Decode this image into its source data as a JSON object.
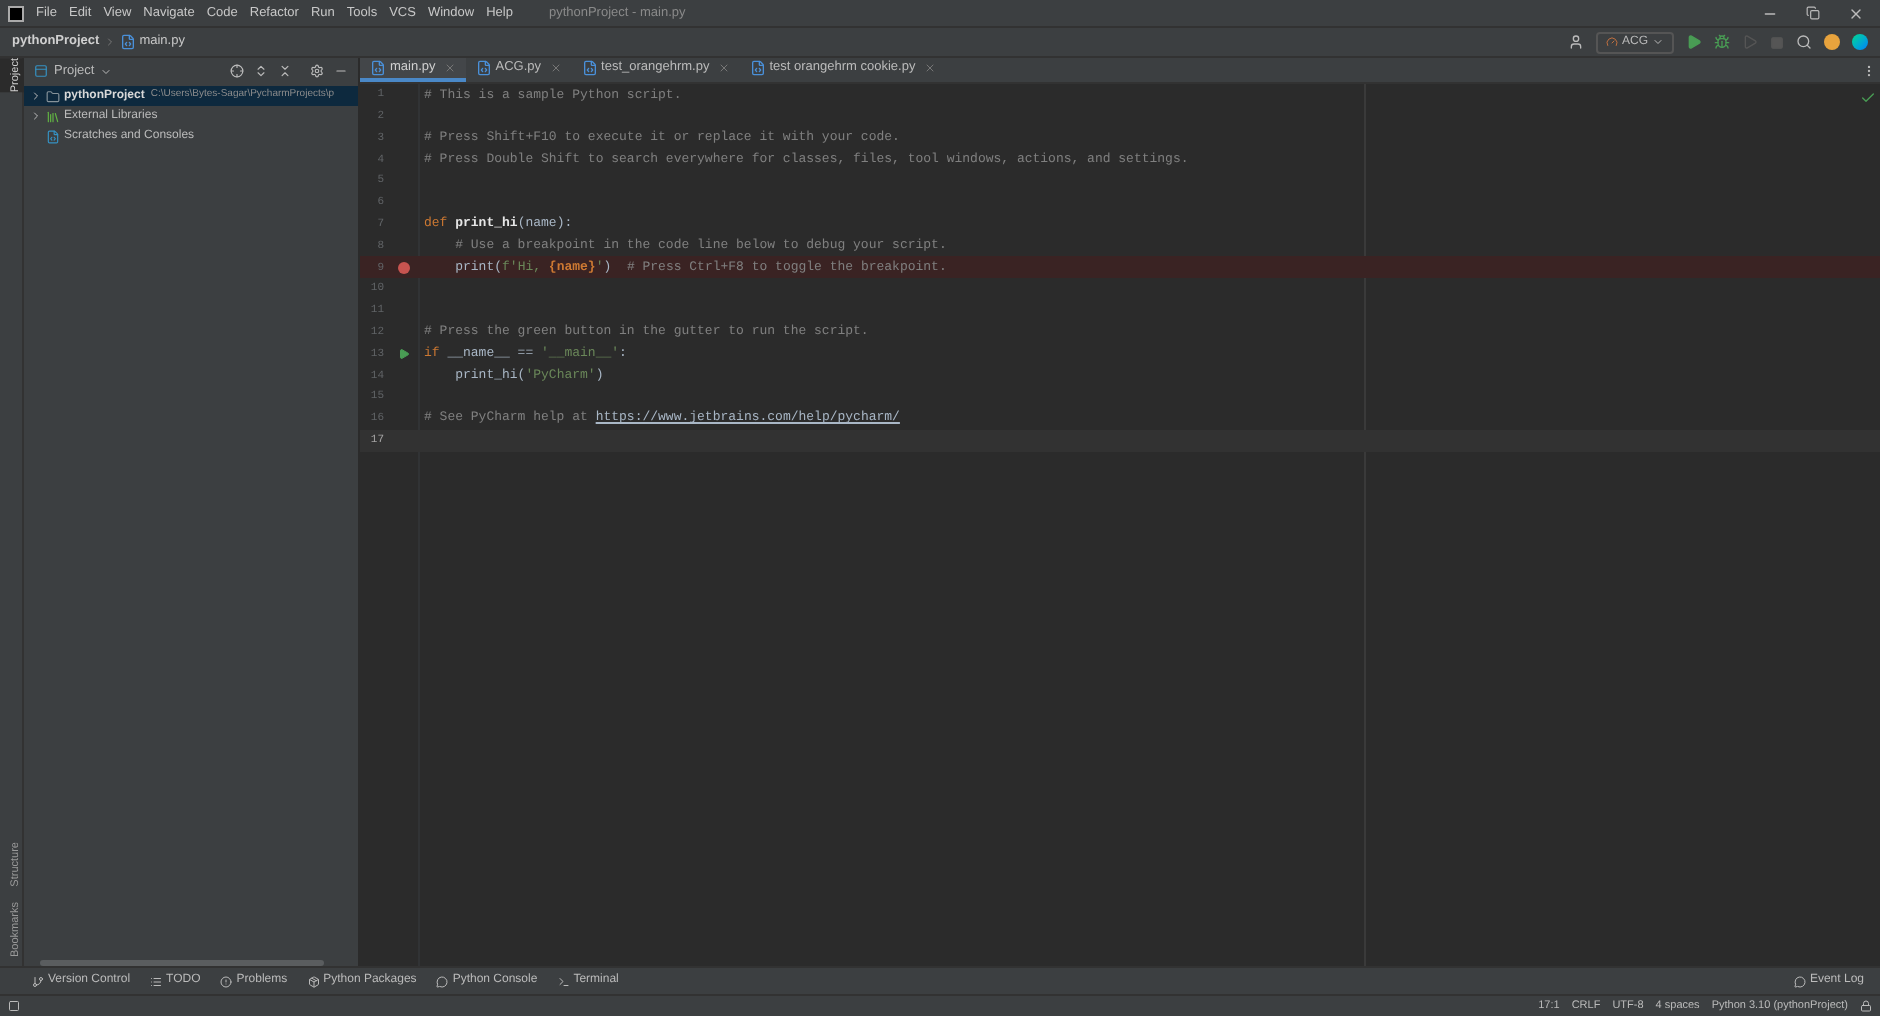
{
  "window": {
    "title": "pythonProject - main.py",
    "menu": [
      "File",
      "Edit",
      "View",
      "Navigate",
      "Code",
      "Refactor",
      "Run",
      "Tools",
      "VCS",
      "Window",
      "Help"
    ]
  },
  "navbar": {
    "breadcrumbs": [
      "pythonProject",
      "main.py"
    ],
    "run_config": "ACG"
  },
  "left_strip": {
    "top": [
      {
        "label": "Project",
        "selected": true
      }
    ],
    "bottom": [
      {
        "label": "Structure",
        "selected": false
      },
      {
        "label": "Bookmarks",
        "selected": false
      }
    ]
  },
  "project_panel": {
    "title": "Project",
    "tree": [
      {
        "label": "pythonProject",
        "path": "C:\\Users\\Bytes-Sagar\\PycharmProjects\\p",
        "kind": "project",
        "expanded": false,
        "selected": true
      },
      {
        "label": "External Libraries",
        "kind": "library",
        "expanded": false,
        "selected": false
      },
      {
        "label": "Scratches and Consoles",
        "kind": "scratches",
        "selected": false
      }
    ]
  },
  "tabs": [
    {
      "label": "main.py",
      "selected": true
    },
    {
      "label": "ACG.py",
      "selected": false
    },
    {
      "label": "test_orangehrm.py",
      "selected": false
    },
    {
      "label": "test orangehrm cookie.py",
      "selected": false
    }
  ],
  "editor": {
    "lines": [
      {
        "number": "1",
        "tokens": [
          {
            "kind": "comment",
            "text": "# This is a sample Python script."
          }
        ],
        "breakpoint": false,
        "run": false,
        "current": false
      },
      {
        "number": "2",
        "breakpoint": false,
        "run": false,
        "current": false
      },
      {
        "number": "3",
        "tokens": [
          {
            "kind": "comment",
            "text": "# Press Shift+F10 to execute it or replace it with your code."
          }
        ],
        "breakpoint": false,
        "run": false,
        "current": false
      },
      {
        "number": "4",
        "tokens": [
          {
            "kind": "comment",
            "text": "# Press Double Shift to search everywhere for classes, files, tool windows, actions, and settings."
          }
        ],
        "breakpoint": false,
        "run": false,
        "current": false
      },
      {
        "number": "5",
        "breakpoint": false,
        "run": false,
        "current": false
      },
      {
        "number": "6",
        "breakpoint": false,
        "run": false,
        "current": false
      },
      {
        "number": "7",
        "tokens": [
          {
            "kind": "keyword",
            "text": "def "
          },
          {
            "kind": "function",
            "text": "print_hi"
          },
          {
            "kind": "plain",
            "text": "(name):"
          }
        ],
        "breakpoint": false,
        "run": false,
        "current": false
      },
      {
        "number": "8",
        "tokens": [
          {
            "kind": "comment",
            "text": "    # Use a breakpoint in the code line below to debug your script."
          }
        ],
        "breakpoint": false,
        "run": false,
        "current": false
      },
      {
        "number": "9",
        "tokens": [
          {
            "kind": "plain",
            "text": "    print("
          },
          {
            "kind": "string",
            "text": "f'Hi, "
          },
          {
            "kind": "param",
            "text": "{name}"
          },
          {
            "kind": "string",
            "text": "'"
          },
          {
            "kind": "plain",
            "text": ")  "
          },
          {
            "kind": "comment",
            "text": "# Press Ctrl+F8 to toggle the breakpoint."
          }
        ],
        "breakpoint": true,
        "run": false,
        "current": false
      },
      {
        "number": "10",
        "breakpoint": false,
        "run": false,
        "current": false
      },
      {
        "number": "11",
        "breakpoint": false,
        "run": false,
        "current": false
      },
      {
        "number": "12",
        "tokens": [
          {
            "kind": "comment",
            "text": "# Press the green button in the gutter to run the script."
          }
        ],
        "breakpoint": false,
        "run": false,
        "current": false
      },
      {
        "number": "13",
        "tokens": [
          {
            "kind": "keyword",
            "text": "if "
          },
          {
            "kind": "plain",
            "text": "__name__ == "
          },
          {
            "kind": "string",
            "text": "'__main__'"
          },
          {
            "kind": "plain",
            "text": ":"
          }
        ],
        "breakpoint": false,
        "run": true,
        "current": false
      },
      {
        "number": "14",
        "tokens": [
          {
            "kind": "plain",
            "text": "    print_hi("
          },
          {
            "kind": "string",
            "text": "'PyCharm'"
          },
          {
            "kind": "plain",
            "text": ")"
          }
        ],
        "breakpoint": false,
        "run": false,
        "current": false
      },
      {
        "number": "15",
        "breakpoint": false,
        "run": false,
        "current": false
      },
      {
        "number": "16",
        "tokens": [
          {
            "kind": "comment",
            "text": "# See PyCharm help at "
          },
          {
            "kind": "link",
            "text": "https://www.jetbrains.com/help/pycharm/"
          }
        ],
        "breakpoint": false,
        "run": false,
        "current": false
      },
      {
        "number": "17",
        "breakpoint": false,
        "run": false,
        "current": true
      }
    ]
  },
  "tool_buttons": [
    {
      "label": "Version Control",
      "kind": "vcs"
    },
    {
      "label": "TODO",
      "kind": "todo"
    },
    {
      "label": "Problems",
      "kind": "problems"
    },
    {
      "label": "Python Packages",
      "kind": "packages"
    },
    {
      "label": "Python Console",
      "kind": "console"
    },
    {
      "label": "Terminal",
      "kind": "terminal"
    }
  ],
  "event_log": "Event Log",
  "status_bar": [
    "17:1",
    "CRLF",
    "UTF-8",
    "4 spaces",
    "Python 3.10 (pythonProject)"
  ]
}
